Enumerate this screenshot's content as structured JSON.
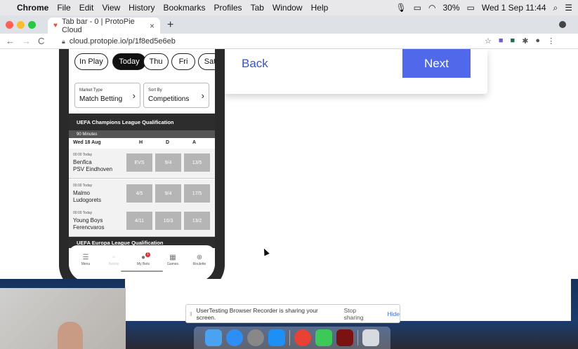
{
  "menubar": {
    "apple": "",
    "app": "Chrome",
    "items": [
      "File",
      "Edit",
      "View",
      "History",
      "Bookmarks",
      "Profiles",
      "Tab",
      "Window",
      "Help"
    ],
    "battery": "30%",
    "datetime": "Wed 1 Sep  11:44"
  },
  "browser": {
    "tab_title": "Tab bar - 0 | ProtoPie Cloud",
    "tab_close": "×",
    "new_tab": "+",
    "url": "cloud.protopie.io/p/1f8ed5e6eb"
  },
  "dialog": {
    "back_label": "Back",
    "next_label": "Next"
  },
  "phone": {
    "day_filters": [
      {
        "label": "In Play",
        "active": false
      },
      {
        "label": "Today",
        "active": true
      },
      {
        "label": "Thu",
        "active": false
      },
      {
        "label": "Fri",
        "active": false
      },
      {
        "label": "Sat",
        "active": false
      }
    ],
    "market": {
      "small": "Market Type",
      "value": "Match Betting"
    },
    "sort": {
      "small": "Sort By",
      "value": "Competitions"
    },
    "section_title": "UEFA Champions League Qualification",
    "subheader": "90 Minutes",
    "date_row": {
      "date": "Wed 18 Aug",
      "h": "H",
      "d": "D",
      "a": "A"
    },
    "matches": [
      {
        "time": "00:00 Today",
        "team1": "Benfica",
        "team2": "PSV Eindhoven",
        "h": "EVS",
        "d": "9/4",
        "a": "13/5"
      },
      {
        "time": "00:00 Today",
        "team1": "Malmo",
        "team2": "Ludogorets",
        "h": "4/5",
        "d": "9/4",
        "a": "17/5"
      },
      {
        "time": "00:00 Today",
        "team1": "Young Boys",
        "team2": "Ferencvaros",
        "h": "4/11",
        "d": "10/3",
        "a": "13/2"
      }
    ],
    "next_section": "UEFA Europa League Qualification",
    "nav": [
      {
        "label": "Menu",
        "icon": "menu-icon"
      },
      {
        "label": "Betslip",
        "icon": "betslip-icon"
      },
      {
        "label": "My Bets",
        "icon": "my-bets-icon",
        "badge": "1"
      },
      {
        "label": "Games",
        "icon": "games-icon"
      },
      {
        "label": "Roulette",
        "icon": "roulette-icon"
      }
    ]
  },
  "share_bar": {
    "message": "UserTesting Browser Recorder is sharing your screen.",
    "stop": "Stop sharing",
    "hide": "Hide"
  }
}
